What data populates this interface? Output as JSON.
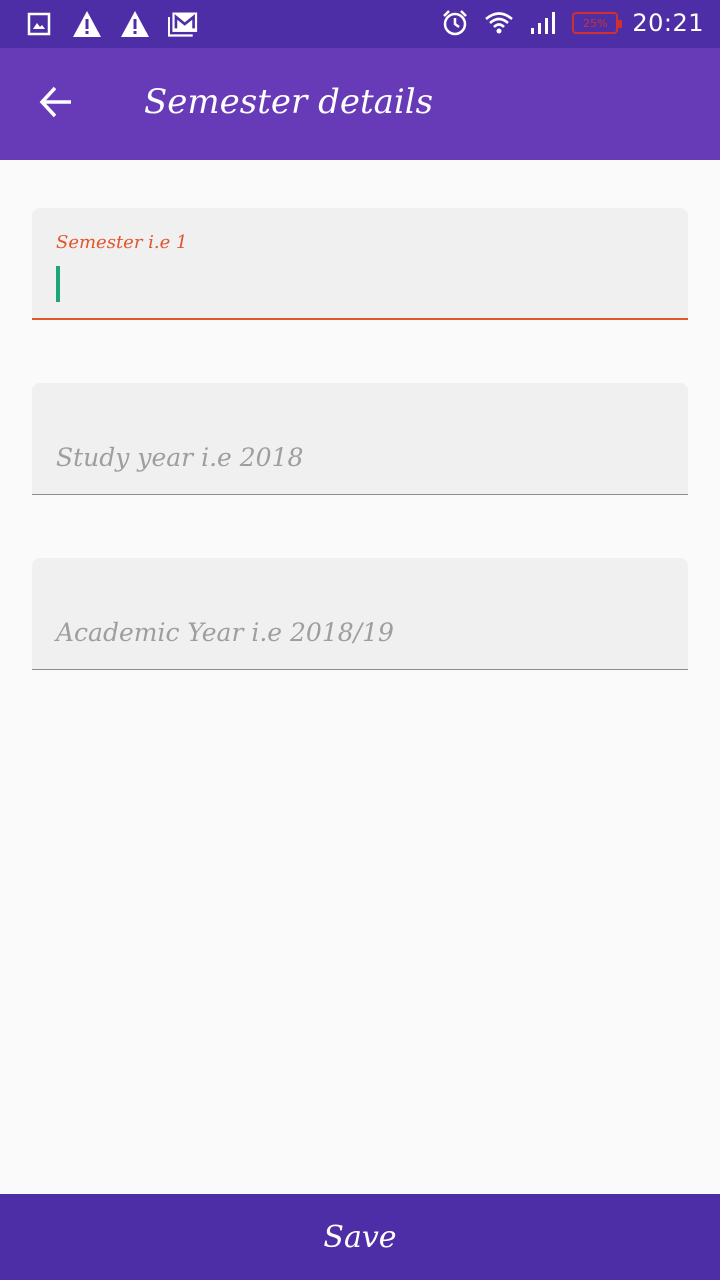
{
  "status_bar": {
    "left_icons": [
      "gallery-icon",
      "warning-icon",
      "warning-icon",
      "gmail-icon"
    ],
    "right_icons": [
      "alarm-icon",
      "wifi-icon",
      "signal-icon"
    ],
    "battery": "25%",
    "time": "20:21"
  },
  "app_bar": {
    "back_icon": "arrow-left-icon",
    "title": "Semester details"
  },
  "form": {
    "semester": {
      "label": "Semester i.e 1",
      "value": ""
    },
    "study_year": {
      "placeholder": "Study year i.e 2018",
      "value": ""
    },
    "academic_year": {
      "placeholder": "Academic Year i.e 2018/19",
      "value": ""
    }
  },
  "save_button": {
    "label": "Save"
  },
  "colors": {
    "status_bar": "#4e2ea6",
    "app_bar": "#673ab7",
    "focus_accent": "#e2552b",
    "caret": "#1da57a",
    "save_bar": "#4e2ea6"
  }
}
